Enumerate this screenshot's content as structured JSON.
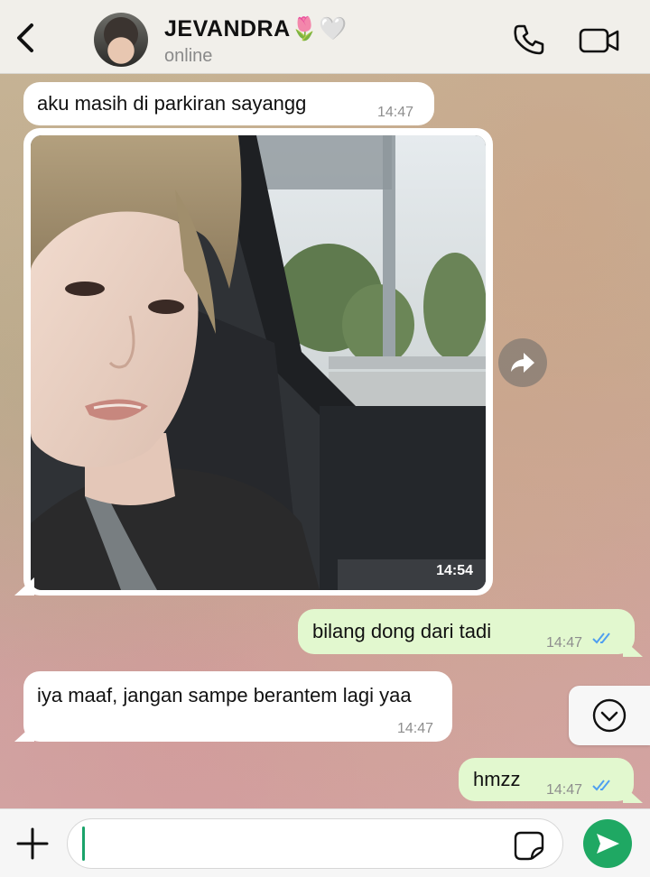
{
  "header": {
    "contact_name": "JEVANDRA🌷🤍",
    "status": "online"
  },
  "messages": [
    {
      "direction": "incoming",
      "type": "text",
      "text": "aku masih di parkiran sayangg",
      "time": "14:47"
    },
    {
      "direction": "incoming",
      "type": "image",
      "time": "14:54"
    },
    {
      "direction": "outgoing",
      "type": "text",
      "text": "bilang dong dari tadi",
      "time": "14:47",
      "read": true
    },
    {
      "direction": "incoming",
      "type": "text",
      "text": "iya maaf, jangan sampe berantem lagi yaa",
      "time": "14:47"
    },
    {
      "direction": "outgoing",
      "type": "text",
      "text": "hmzz",
      "time": "14:47",
      "read": true
    }
  ],
  "input": {
    "value": "",
    "placeholder": ""
  },
  "icons": {
    "back": "chevron-left-icon",
    "call": "phone-icon",
    "video": "video-camera-icon",
    "forward": "forward-arrow-icon",
    "scroll_down": "chevron-down-circle-icon",
    "attach": "plus-icon",
    "sticker": "sticker-icon",
    "send": "send-icon",
    "read_receipt": "double-check-icon"
  },
  "colors": {
    "outgoing_bubble": "#e2f8cf",
    "incoming_bubble": "#ffffff",
    "send_button": "#1fa863",
    "read_ticks": "#4f9ff0"
  }
}
